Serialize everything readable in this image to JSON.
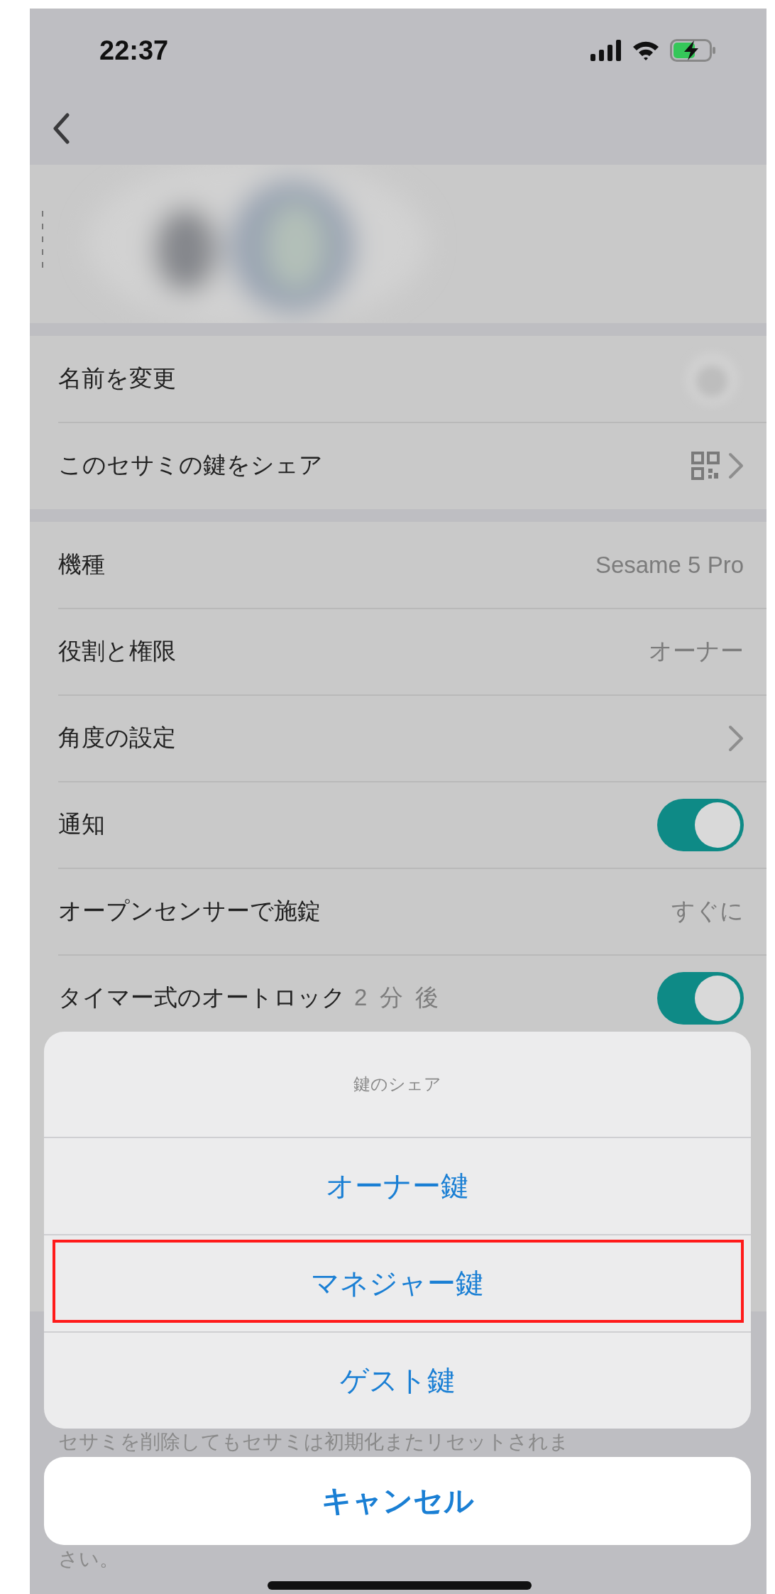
{
  "status_bar": {
    "time": "22:37"
  },
  "picture": {
    "kind": "picture"
  },
  "groups": [
    {
      "rows": [
        {
          "kind": "avatar",
          "label": "名前を変更"
        },
        {
          "kind": "qr_chevron",
          "label": "このセサミの鍵をシェア"
        }
      ]
    },
    {
      "rows": [
        {
          "kind": "value",
          "label": "機種",
          "value": "Sesame 5 Pro"
        },
        {
          "kind": "value",
          "label": "役割と権限",
          "value": "オーナー"
        },
        {
          "kind": "chevron",
          "label": "角度の設定"
        },
        {
          "kind": "toggle",
          "label": "通知",
          "on": true
        },
        {
          "kind": "value",
          "label": "オープンセンサーで施錠",
          "value": "すぐに"
        },
        {
          "kind": "toggle",
          "label": "タイマー式のオートロック",
          "note": "2 分 後",
          "on": true
        }
      ]
    }
  ],
  "footer_lines": [
    "セサミを削除してもセサミは初期化またリセットされま",
    "さい。"
  ],
  "action_sheet": {
    "title": "鍵のシェア",
    "options": [
      {
        "label": "オーナー鍵",
        "highlighted": false
      },
      {
        "label": "マネジャー鍵",
        "highlighted": true
      },
      {
        "label": "ゲスト鍵",
        "highlighted": false
      }
    ],
    "cancel": "キャンセル"
  }
}
